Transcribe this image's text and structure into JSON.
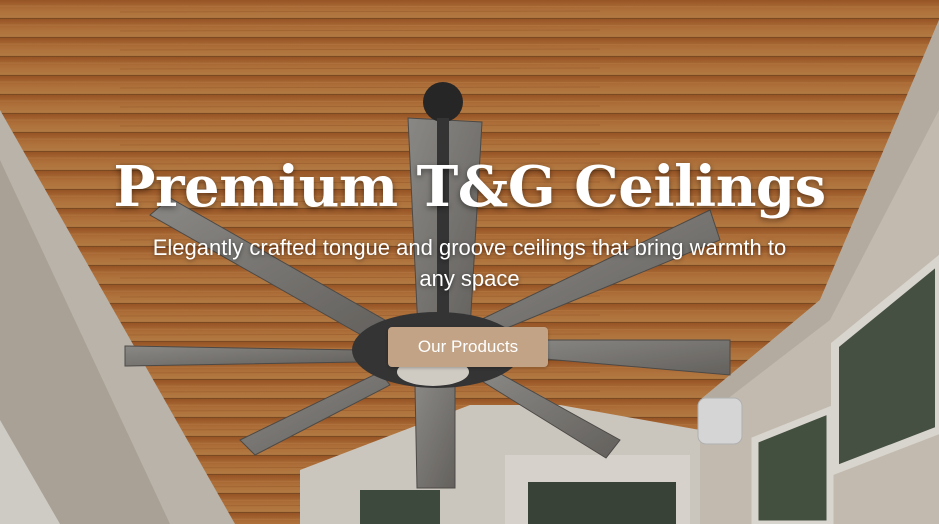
{
  "hero": {
    "title": "Premium T&G Ceilings",
    "subtitle": "Elegantly crafted tongue and groove ceilings that bring warmth to any space",
    "cta_label": "Our Products"
  },
  "colors": {
    "cta_background": "#c3a385",
    "text": "#ffffff",
    "wood": "#b06a32"
  }
}
